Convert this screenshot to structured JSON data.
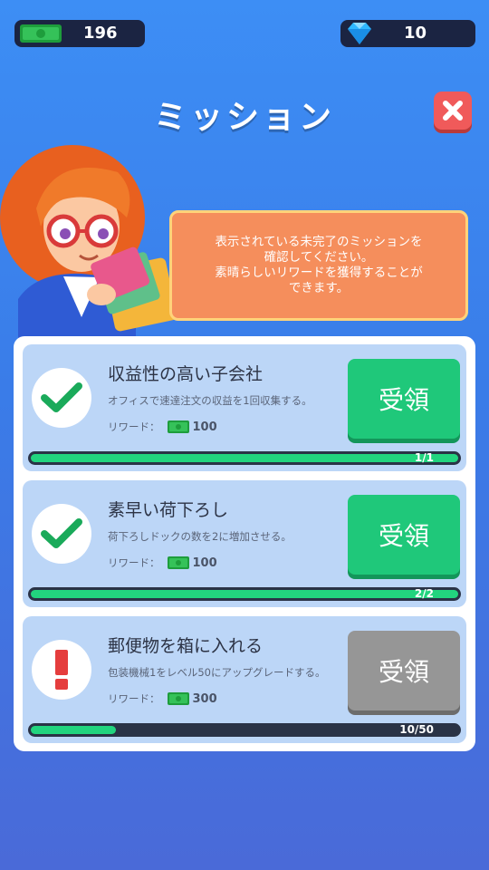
{
  "currency": {
    "cash": "196",
    "gems": "10",
    "cash_icon": "cash-icon",
    "gem_icon": "diamond-icon"
  },
  "header": {
    "title": "ミッション",
    "close_icon": "close-icon"
  },
  "intro": {
    "text": "表示されている未完了のミッションを\n確認してください。\n素晴らしいリワードを獲得することが\nできます。"
  },
  "colors": {
    "background": "#3d8ef5",
    "claim_active": "#1fc87a",
    "claim_disabled": "#969696",
    "progress_fill": "#22d47e",
    "close_button": "#f05a5a"
  },
  "missions": [
    {
      "title": "収益性の高い子会社",
      "description": "オフィスで速達注文の収益を1回収集する。",
      "reward_label": "リワード：",
      "reward_amount": "100",
      "claim_label": "受領",
      "progress_text": "1/1",
      "progress": 1.0,
      "status_icon": "checkmark-icon",
      "claimable": true
    },
    {
      "title": "素早い荷下ろし",
      "description": "荷下ろしドックの数を2に増加させる。",
      "reward_label": "リワード：",
      "reward_amount": "100",
      "claim_label": "受領",
      "progress_text": "2/2",
      "progress": 1.0,
      "status_icon": "checkmark-icon",
      "claimable": true
    },
    {
      "title": "郵便物を箱に入れる",
      "description": "包装機械1をレベル50にアップグレードする。",
      "reward_label": "リワード：",
      "reward_amount": "300",
      "claim_label": "受領",
      "progress_text": "10/50",
      "progress": 0.2,
      "status_icon": "exclamation-icon",
      "claimable": false
    }
  ]
}
